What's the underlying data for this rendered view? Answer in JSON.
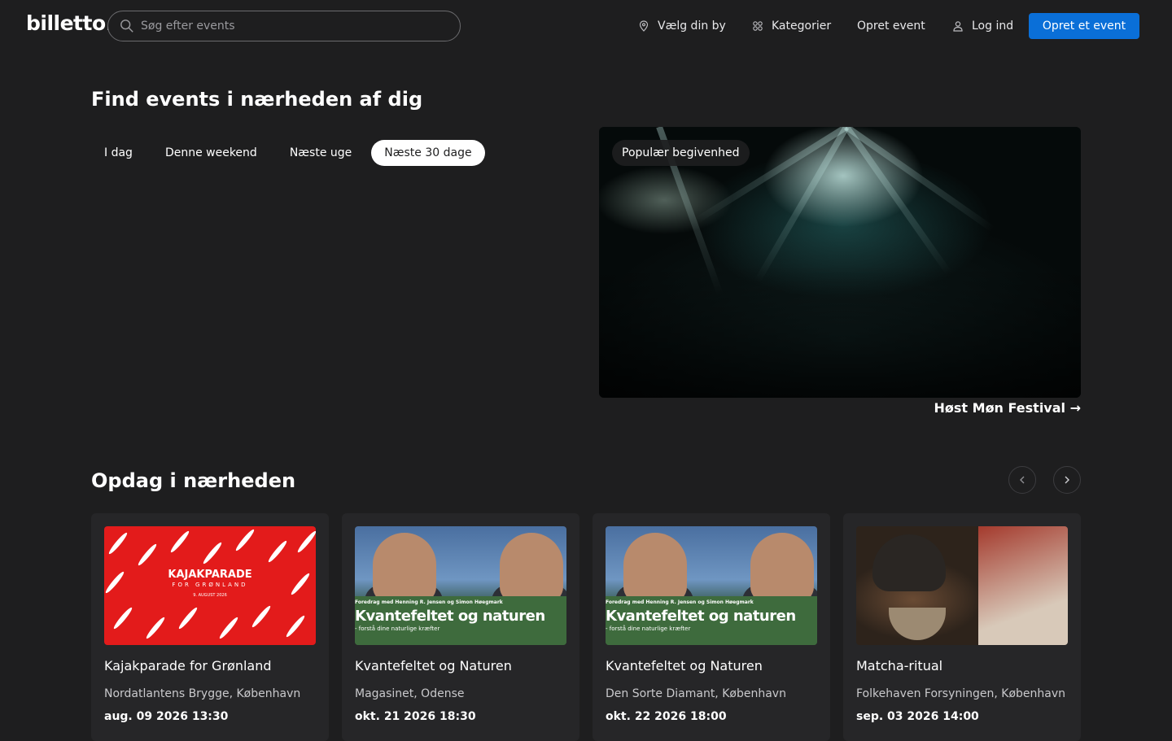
{
  "header": {
    "logo": "billetto.",
    "search_placeholder": "Søg efter events",
    "city_label": "Vælg din by",
    "categories_label": "Kategorier",
    "create_event_label": "Opret event",
    "login_label": "Log ind",
    "primary_button": "Opret et event"
  },
  "hero": {
    "title": "Find events i nærheden af dig",
    "tabs": [
      {
        "label": "I dag"
      },
      {
        "label": "Denne weekend"
      },
      {
        "label": "Næste uge"
      },
      {
        "label": "Næste 30 dage"
      }
    ],
    "active_tab": "Næste 30 dage",
    "featured": {
      "badge": "Populær begivenhed",
      "link": "Høst Møn Festival →"
    }
  },
  "discover": {
    "title": "Opdag i nærheden",
    "cards": [
      {
        "title": "Kajakparade for Grønland",
        "location": "Nordatlantens Brygge, København",
        "date": "aug. 09 2026 13:30",
        "image": {
          "heading": "KAJAKPARADE",
          "sub": "FOR GRØNLAND",
          "date": "9. AUGUST 2026"
        }
      },
      {
        "title": "Kvantefeltet og Naturen",
        "location": "Magasinet, Odense",
        "date": "okt. 21 2026 18:30",
        "image": {
          "line1": "Foredrag med Henning R. Jensen og Simon Høegmark",
          "line2": "Kvantefeltet og naturen",
          "line3": "- forstå dine naturlige kræfter"
        }
      },
      {
        "title": "Kvantefeltet og Naturen",
        "location": "Den Sorte Diamant, København",
        "date": "okt. 22 2026 18:00",
        "image": {
          "line1": "Foredrag med Henning R. Jensen og Simon Høegmark",
          "line2": "Kvantefeltet og naturen",
          "line3": "- forstå dine naturlige kræfter"
        }
      },
      {
        "title": "Matcha-ritual",
        "location": "Folkehaven Forsyningen, København",
        "date": "sep. 03 2026 14:00",
        "image": {}
      }
    ]
  },
  "colors": {
    "background": "#1e1e1f",
    "primary": "#0a6fd8",
    "card": "#262628"
  }
}
